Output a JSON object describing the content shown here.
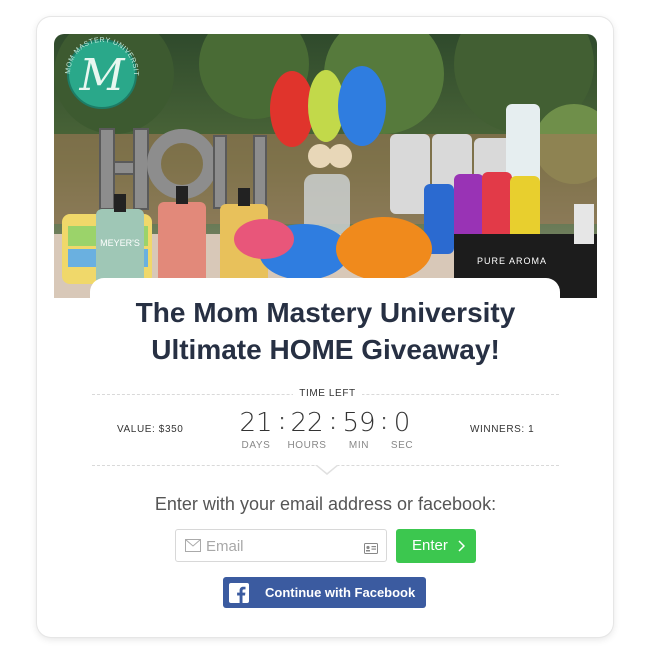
{
  "hero": {
    "logo_text": "MOM MASTERY UNIVERSITY",
    "sign_text": "HOME",
    "product_label_1": "MEYER'S",
    "product_label_2": "PURE AROMA"
  },
  "giveaway": {
    "title_line1": "The Mom Mastery University",
    "title_line2": "Ultimate HOME Giveaway!"
  },
  "countdown": {
    "label": "TIME LEFT",
    "value_label": "VALUE: $350",
    "winners_label": "WINNERS: 1",
    "days": "21",
    "hours": "22",
    "minutes": "59",
    "seconds": "0",
    "days_unit": "DAYS",
    "hours_unit": "HOURS",
    "minutes_unit": "MIN",
    "seconds_unit": "SEC"
  },
  "entry": {
    "prompt": "Enter with your email address or facebook:",
    "email_placeholder": "Email",
    "enter_label": "Enter",
    "facebook_label": "Continue with Facebook"
  },
  "colors": {
    "enter_button": "#3cc74f",
    "facebook_button": "#3b5ba0",
    "title": "#273043",
    "logo": "#2aa88a"
  }
}
